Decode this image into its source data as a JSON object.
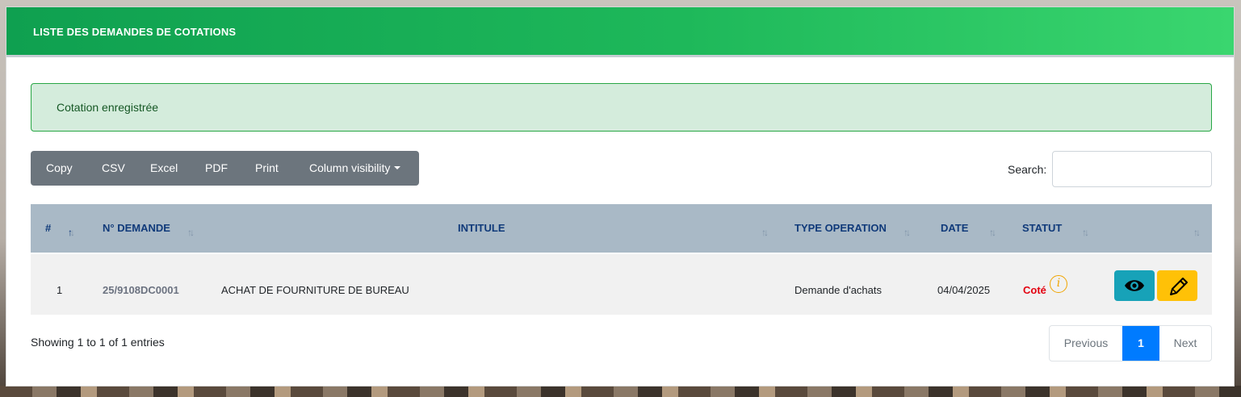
{
  "header": {
    "title": "LISTE DES DEMANDES DE COTATIONS"
  },
  "alert": {
    "message": "Cotation enregistrée"
  },
  "toolbar": {
    "buttons": [
      "Copy",
      "CSV",
      "Excel",
      "PDF",
      "Print",
      "Column visibility"
    ]
  },
  "search": {
    "label": "Search:",
    "value": "",
    "placeholder": ""
  },
  "table": {
    "columns": [
      "#",
      "N° DEMANDE",
      "INTITULE",
      "TYPE OPERATION",
      "DATE",
      "STATUT",
      ""
    ],
    "rows": [
      {
        "index": "1",
        "numero": "25/9108DC0001",
        "intitule": "ACHAT DE FOURNITURE DE BUREAU",
        "type_operation": "Demande d'achats",
        "date": "04/04/2025",
        "statut": "Coté"
      }
    ]
  },
  "footer": {
    "info": "Showing 1 to 1 of 1 entries"
  },
  "pagination": {
    "previous": "Previous",
    "current": "1",
    "next": "Next"
  },
  "colors": {
    "header_gradient_start": "#0fa050",
    "header_gradient_end": "#3ad66f",
    "alert_bg": "#d4ecdc",
    "table_head_bg": "#a9b9c6",
    "status_red": "#e3000f",
    "view_button": "#17a2b8",
    "edit_button": "#ffc107",
    "active_page": "#007bff"
  }
}
